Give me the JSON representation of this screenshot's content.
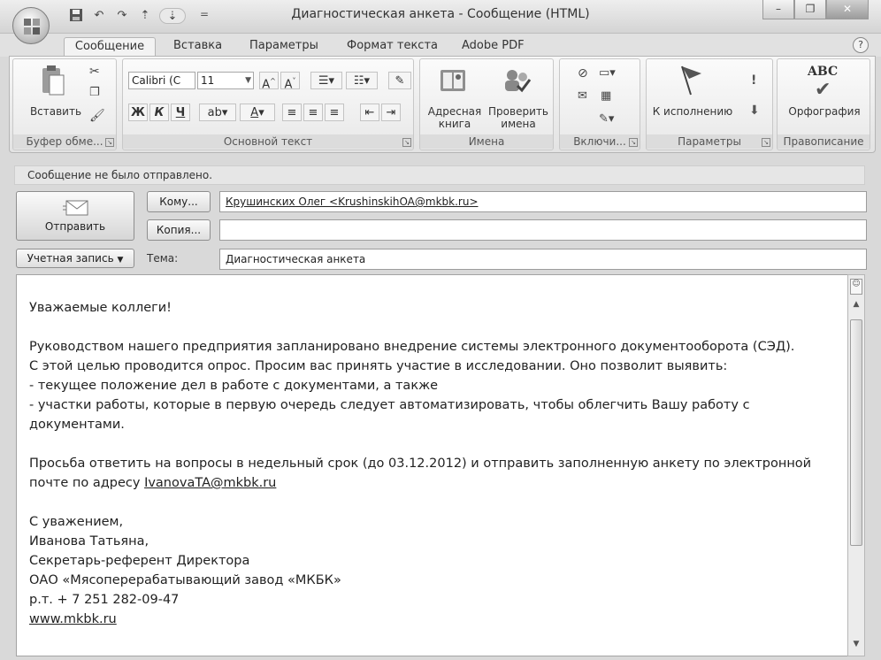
{
  "window": {
    "title": "Диагностическая анкета  - Сообщение (HTML)",
    "minimize": "–",
    "maximize": "❐",
    "close": "✕"
  },
  "qat": {
    "save": "💾",
    "undo": "↶",
    "redo": "↷",
    "up": "⇡",
    "down": "⇣",
    "customize": "="
  },
  "tabs": [
    {
      "label": "Сообщение"
    },
    {
      "label": "Вставка"
    },
    {
      "label": "Параметры"
    },
    {
      "label": "Формат текста"
    },
    {
      "label": "Adobe PDF"
    }
  ],
  "ribbon": {
    "clipboard": {
      "paste_label": "Вставить",
      "group_label": "Буфер обме..."
    },
    "basic_text": {
      "font_name": "Calibri (С",
      "font_size": "11",
      "bold": "Ж",
      "italic": "К",
      "underline": "Ч",
      "group_label": "Основной текст"
    },
    "names": {
      "address_book": "Адресная книга",
      "check_names": "Проверить имена",
      "group_label": "Имена"
    },
    "include": {
      "group_label": "Включи..."
    },
    "options": {
      "follow_up": "К исполнению",
      "group_label": "Параметры"
    },
    "proofing": {
      "spelling": "Орфография",
      "abc": "ABC",
      "group_label": "Правописание"
    }
  },
  "infobar": {
    "text": "Сообщение не было отправлено."
  },
  "header": {
    "send_label": "Отправить",
    "to_button": "Кому...",
    "cc_button": "Копия...",
    "account_button": "Учетная запись",
    "subject_label": "Тема:",
    "to_value": "Крушинских Олег <KrushinskihOA@mkbk.ru>",
    "cc_value": "",
    "subject_value": "Диагностическая анкета"
  },
  "body": {
    "greeting": "Уважаемые коллеги!",
    "p1_line1": "Руководством нашего предприятия запланировано внедрение системы электронного документооборота (СЭД).",
    "p1_line2": "С этой целью проводится опрос. Просим вас принять участие в исследовании. Оно позволит выявить:",
    "p1_line3": "-  текущее положение дел в работе с документами, а также",
    "p1_line4": "-  участки работы, которые в первую очередь следует автоматизировать, чтобы облегчить Вашу работу с",
    "p1_line5": "документами.",
    "p2_line1": "Просьба ответить на вопросы в недельный срок (до 03.12.2012) и отправить заполненную анкету по электронной",
    "p2_line2_prefix": "почте по адресу ",
    "p2_email": "IvanovaTA@mkbk.ru",
    "sig1": "С уважением,",
    "sig2": "Иванова Татьяна,",
    "sig3": "Секретарь-референт Директора",
    "sig4": "ОАО «Мясоперерабатывающий завод «МКБК»",
    "sig5": "р.т. + 7 251 282-09-47",
    "sig6": "www.mkbk.ru"
  }
}
